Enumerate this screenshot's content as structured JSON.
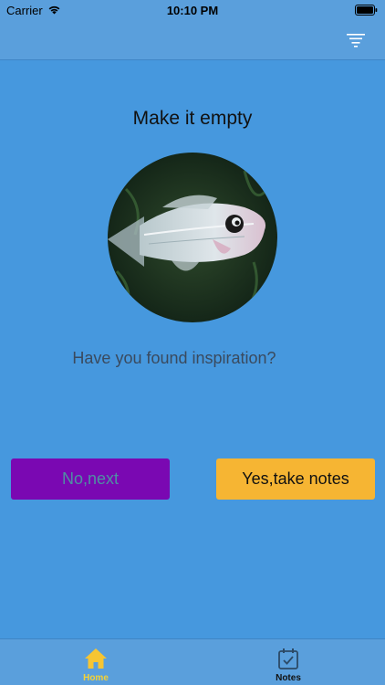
{
  "status_bar": {
    "carrier": "Carrier",
    "time": "10:10 PM"
  },
  "nav": {
    "filter_icon": "filter-icon"
  },
  "main": {
    "title": "Make it empty",
    "image": "fish-photo",
    "prompt": "Have you found inspiration?",
    "no_button": "No,next",
    "yes_button": "Yes,take notes"
  },
  "tabs": [
    {
      "label": "Home",
      "icon": "home-icon",
      "active": true
    },
    {
      "label": "Notes",
      "icon": "notes-icon",
      "active": false
    }
  ],
  "colors": {
    "background": "#4698de",
    "no_button": "#7a08b2",
    "yes_button": "#f6b533",
    "active_tab": "#f6d233"
  }
}
